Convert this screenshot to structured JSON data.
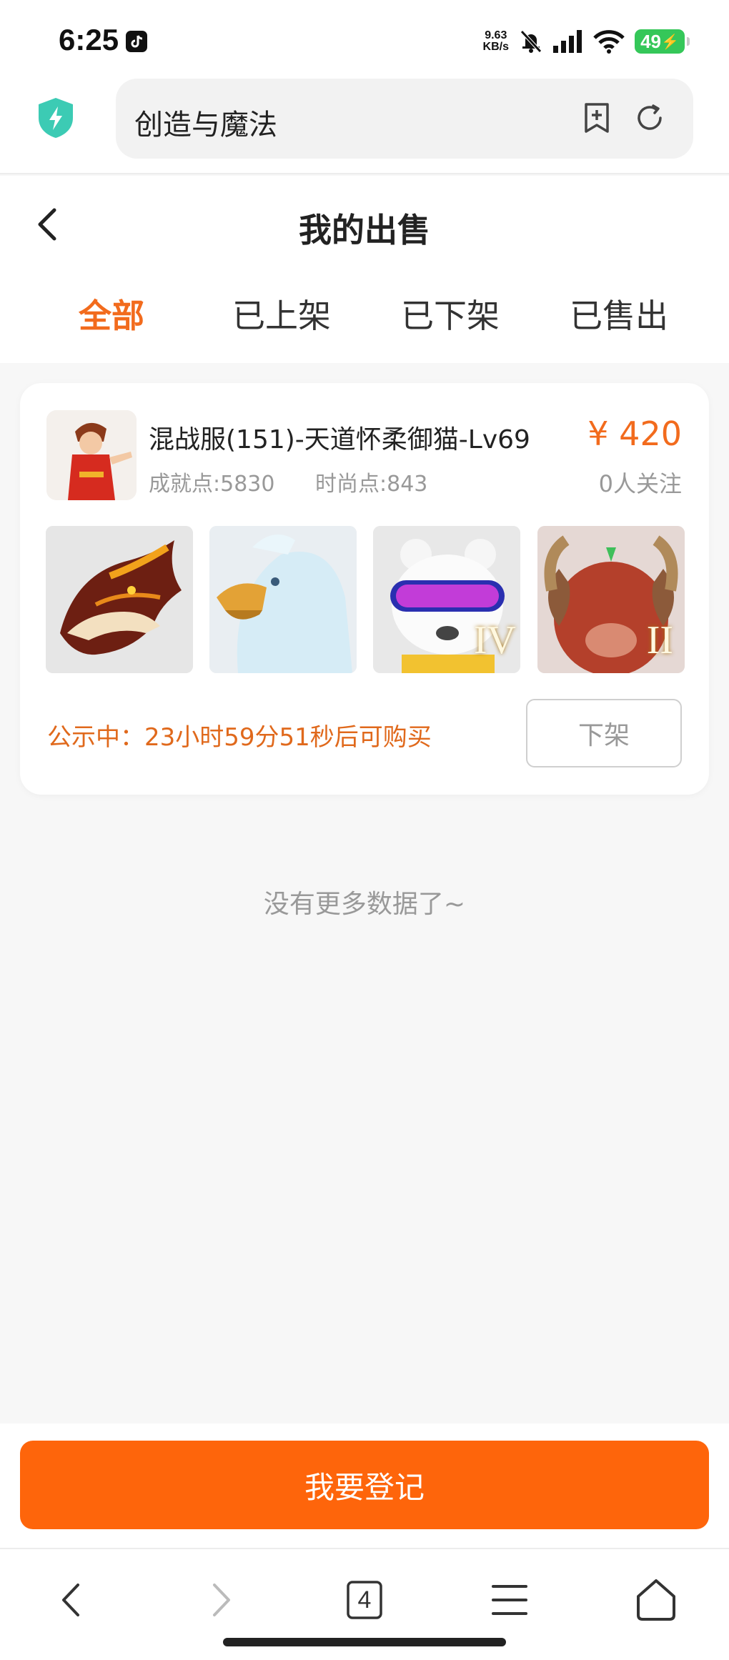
{
  "status_bar": {
    "time": "6:25",
    "net_speed_value": "9.63",
    "net_speed_unit": "KB/s",
    "battery": "49"
  },
  "browser": {
    "url_text": "创造与魔法",
    "open_tabs": "4"
  },
  "header": {
    "title": "我的出售"
  },
  "tabs": [
    {
      "label": "全部",
      "active": true
    },
    {
      "label": "已上架",
      "active": false
    },
    {
      "label": "已下架",
      "active": false
    },
    {
      "label": "已售出",
      "active": false
    }
  ],
  "listing": {
    "title": "混战服(151)-天道怀柔御猫-Lv69",
    "achievement": "成就点:5830",
    "fashion": "时尚点:843",
    "price": "¥ 420",
    "followers": "0人关注",
    "thumbnails": [
      {
        "name": "fire-dragon-mount",
        "badge": ""
      },
      {
        "name": "white-eagle-mount",
        "badge": ""
      },
      {
        "name": "polar-bear-goggles",
        "badge": "IV"
      },
      {
        "name": "red-ram-beast",
        "badge": "II"
      }
    ],
    "notice": "公示中：23小时59分51秒后可购买",
    "delist_label": "下架"
  },
  "no_more_text": "没有更多数据了~",
  "register_label": "我要登记",
  "colors": {
    "accent": "#f26b1d",
    "register_button": "#fe650b",
    "battery": "#35c759",
    "shield": "#3ccbb4"
  }
}
